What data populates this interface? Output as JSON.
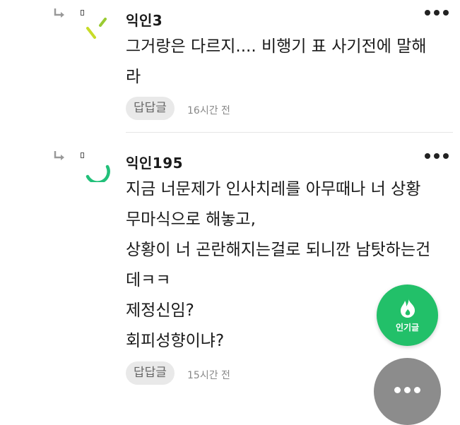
{
  "comments": [
    {
      "author": "익인3",
      "lines": [
        "그거랑은 다르지.... 비행기 표 사기전에 말해",
        "라"
      ],
      "reply_label": "답답글",
      "time": "16시간 전",
      "avatar_color": "#b8d432"
    },
    {
      "author": "익인195",
      "lines": [
        "지금 너문제가 인사치레를 아무때나 너 상황",
        "무마식으로 해놓고,",
        "상황이 너 곤란해지는걸로 되니깐 남탓하는건",
        "데ㅋㅋ",
        "제정신임?",
        "회피성향이냐?"
      ],
      "reply_label": "답답글",
      "time": "15시간 전",
      "avatar_color": "#22c07a"
    }
  ],
  "fab": {
    "popular_label": "인기글",
    "popular_color": "#22c069",
    "more_color": "#8c8c8c"
  },
  "icons": {
    "reply_arrow": "reply-arrow-icon",
    "more": "more-dots-icon",
    "fire": "fire-icon"
  }
}
